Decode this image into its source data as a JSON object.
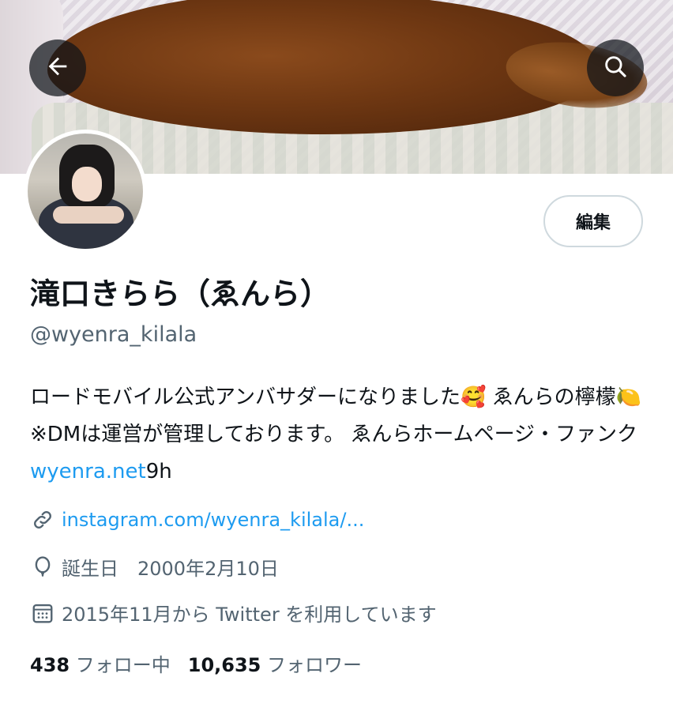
{
  "profile": {
    "edit_label": "編集",
    "display_name": "滝口きらら（ゑんら）",
    "handle": "@wyenra_kilala",
    "bio": {
      "text": "ロードモバイル公式アンバサダーになりました🥰 ゑんらの檸檬🍋※DMは運営が管理しております。 ゑんらホームページ・ファンク",
      "link_text": "wyenra.net",
      "trailing": "9h"
    },
    "website": "instagram.com/wyenra_kilala/...",
    "birthday": "誕生日　2000年2月10日",
    "joined": "2015年11月から Twitter を利用しています",
    "following_count": "438",
    "following_label": "フォロー中",
    "followers_count": "10,635",
    "followers_label": "フォロワー"
  },
  "icons": {
    "back": "arrow-left-icon",
    "search": "search-icon",
    "link": "link-icon",
    "birthday": "balloon-icon",
    "joined": "calendar-icon"
  },
  "colors": {
    "accent": "#1d9bf0",
    "text_primary": "#0f1419",
    "text_secondary": "#536471",
    "border": "#cfd9de"
  }
}
